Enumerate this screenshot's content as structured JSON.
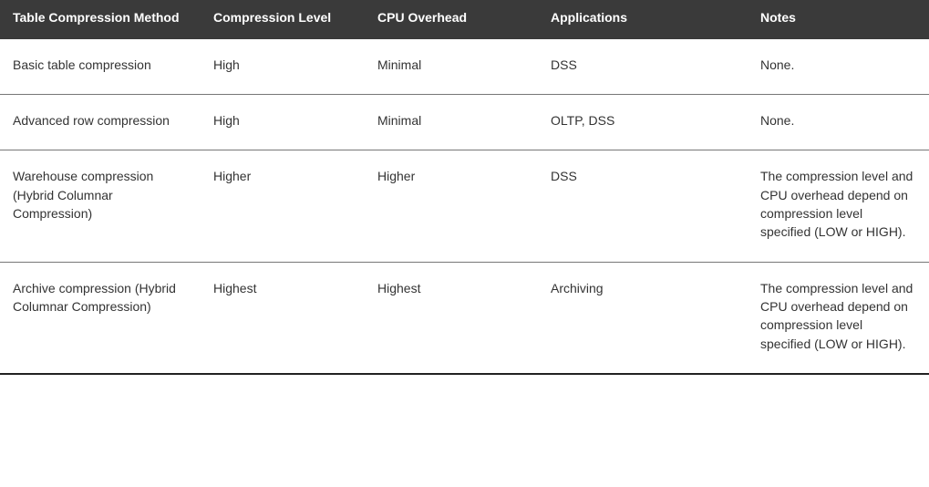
{
  "table": {
    "headers": {
      "method": "Table Compression Method",
      "level": "Compression Level",
      "cpu": "CPU Overhead",
      "apps": "Applications",
      "notes": "Notes"
    },
    "rows": [
      {
        "method": "Basic table compression",
        "level": "High",
        "cpu": "Minimal",
        "apps": "DSS",
        "notes": "None."
      },
      {
        "method": "Advanced row compression",
        "level": "High",
        "cpu": "Minimal",
        "apps": "OLTP, DSS",
        "notes": "None."
      },
      {
        "method": "Warehouse compression (Hybrid Columnar Compression)",
        "level": "Higher",
        "cpu": "Higher",
        "apps": "DSS",
        "notes": "The compression level and CPU overhead depend on compression level specified (LOW or HIGH)."
      },
      {
        "method": "Archive compression (Hybrid Columnar Compression)",
        "level": "Highest",
        "cpu": "Highest",
        "apps": "Archiving",
        "notes": "The compression level and CPU overhead depend on compression level specified (LOW or HIGH)."
      }
    ]
  }
}
